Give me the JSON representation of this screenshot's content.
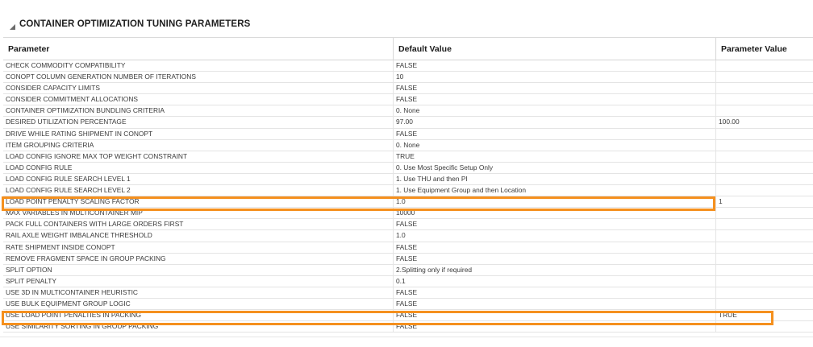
{
  "section": {
    "title": "CONTAINER OPTIMIZATION TUNING PARAMETERS",
    "icon": "collapse-triangle-icon"
  },
  "table": {
    "columns": [
      "Parameter",
      "Default Value",
      "Parameter Value"
    ],
    "rows": [
      {
        "parameter": "CHECK COMMODITY COMPATIBILITY",
        "default": "FALSE",
        "value": ""
      },
      {
        "parameter": "CONOPT COLUMN GENERATION NUMBER OF ITERATIONS",
        "default": "10",
        "value": ""
      },
      {
        "parameter": "CONSIDER CAPACITY LIMITS",
        "default": "FALSE",
        "value": ""
      },
      {
        "parameter": "CONSIDER COMMITMENT ALLOCATIONS",
        "default": "FALSE",
        "value": ""
      },
      {
        "parameter": "CONTAINER OPTIMIZATION BUNDLING CRITERIA",
        "default": "0. None",
        "value": ""
      },
      {
        "parameter": "DESIRED UTILIZATION PERCENTAGE",
        "default": "97.00",
        "value": "100.00"
      },
      {
        "parameter": "DRIVE WHILE RATING SHIPMENT IN CONOPT",
        "default": "FALSE",
        "value": ""
      },
      {
        "parameter": "ITEM GROUPING CRITERIA",
        "default": "0. None",
        "value": ""
      },
      {
        "parameter": "LOAD CONFIG IGNORE MAX TOP WEIGHT CONSTRAINT",
        "default": "TRUE",
        "value": ""
      },
      {
        "parameter": "LOAD CONFIG RULE",
        "default": "0. Use Most Specific Setup Only",
        "value": ""
      },
      {
        "parameter": "LOAD CONFIG RULE SEARCH LEVEL 1",
        "default": "1. Use THU and then PI",
        "value": ""
      },
      {
        "parameter": "LOAD CONFIG RULE SEARCH LEVEL 2",
        "default": "1. Use Equipment Group and then Location",
        "value": ""
      },
      {
        "parameter": "LOAD POINT PENALTY SCALING FACTOR",
        "default": "1.0",
        "value": "1"
      },
      {
        "parameter": "MAX VARIABLES IN MULTICONTAINER MIP",
        "default": "10000",
        "value": ""
      },
      {
        "parameter": "PACK FULL CONTAINERS WITH LARGE ORDERS FIRST",
        "default": "FALSE",
        "value": ""
      },
      {
        "parameter": "RAIL AXLE WEIGHT IMBALANCE THRESHOLD",
        "default": "1.0",
        "value": ""
      },
      {
        "parameter": "RATE SHIPMENT INSIDE CONOPT",
        "default": "FALSE",
        "value": ""
      },
      {
        "parameter": "REMOVE FRAGMENT SPACE IN GROUP PACKING",
        "default": "FALSE",
        "value": ""
      },
      {
        "parameter": "SPLIT OPTION",
        "default": "2.Splitting only if required",
        "value": ""
      },
      {
        "parameter": "SPLIT PENALTY",
        "default": "0.1",
        "value": ""
      },
      {
        "parameter": "USE 3D IN MULTICONTAINER HEURISTIC",
        "default": "FALSE",
        "value": ""
      },
      {
        "parameter": "USE BULK EQUIPMENT GROUP LOGIC",
        "default": "FALSE",
        "value": ""
      },
      {
        "parameter": "USE LOAD POINT PENALTIES IN PACKING",
        "default": "FALSE",
        "value": "TRUE"
      },
      {
        "parameter": "USE SIMILARITY SORTING IN GROUP PACKING",
        "default": "FALSE",
        "value": ""
      }
    ]
  },
  "highlight_color": "#f5901e"
}
